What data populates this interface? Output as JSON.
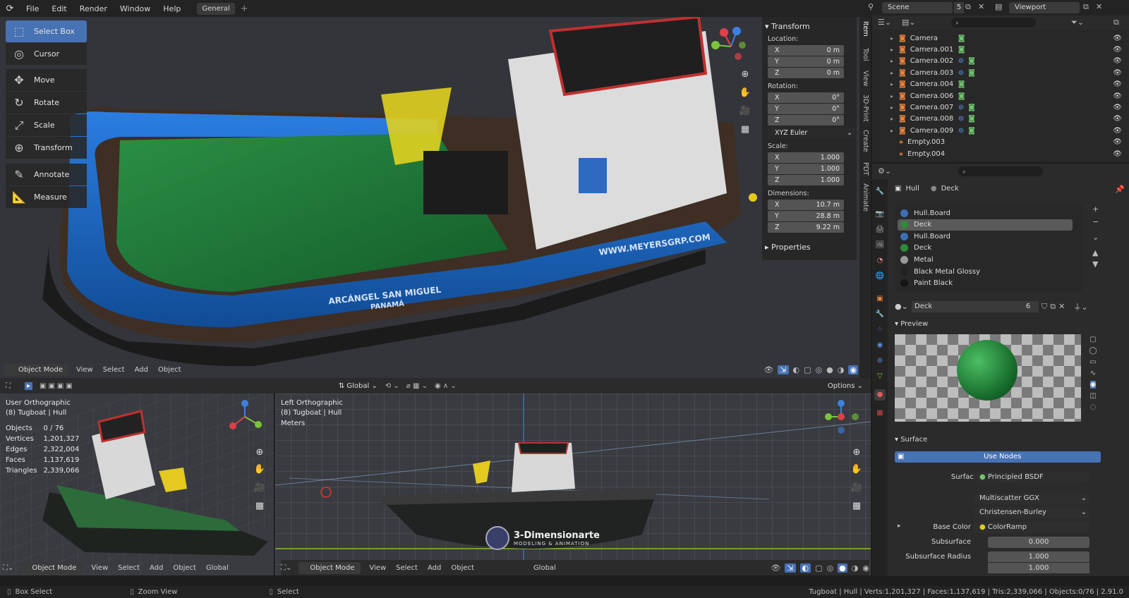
{
  "menubar": {
    "items": [
      "File",
      "Edit",
      "Render",
      "Window",
      "Help"
    ],
    "workspace_tab": "General",
    "add_tab": "+",
    "scene": "Scene",
    "scene_count": "5",
    "view_layer": "Viewport"
  },
  "tools": [
    {
      "label": "Select Box",
      "icon": "select-box-icon",
      "glyph": "⬚"
    },
    {
      "label": "Cursor",
      "icon": "cursor-icon",
      "glyph": "◎"
    },
    {
      "label": "Move",
      "icon": "move-icon",
      "glyph": "✥"
    },
    {
      "label": "Rotate",
      "icon": "rotate-icon",
      "glyph": "↻"
    },
    {
      "label": "Scale",
      "icon": "scale-icon",
      "glyph": "⤢"
    },
    {
      "label": "Transform",
      "icon": "transform-icon",
      "glyph": "⊕"
    },
    {
      "label": "Annotate",
      "icon": "annotate-icon",
      "glyph": "✎"
    },
    {
      "label": "Measure",
      "icon": "measure-icon",
      "glyph": "📐"
    }
  ],
  "viewport_labels": {
    "ship_url": "WWW.MEYERSGRP.COM",
    "ship_name": "ARCÁNGEL SAN MIGUEL",
    "ship_port": "PANAMÁ"
  },
  "npanel": {
    "title": "Transform",
    "location_label": "Location:",
    "location": [
      [
        "X",
        "0 m"
      ],
      [
        "Y",
        "0 m"
      ],
      [
        "Z",
        "0 m"
      ]
    ],
    "rotation_label": "Rotation:",
    "rotation": [
      [
        "X",
        "0°"
      ],
      [
        "Y",
        "0°"
      ],
      [
        "Z",
        "0°"
      ]
    ],
    "rotation_mode": "XYZ Euler",
    "scale_label": "Scale:",
    "scale": [
      [
        "X",
        "1.000"
      ],
      [
        "Y",
        "1.000"
      ],
      [
        "Z",
        "1.000"
      ]
    ],
    "dimensions_label": "Dimensions:",
    "dimensions": [
      [
        "X",
        "10.7 m"
      ],
      [
        "Y",
        "28.8 m"
      ],
      [
        "Z",
        "9.22 m"
      ]
    ],
    "properties": "Properties",
    "tabs": [
      "Item",
      "Tool",
      "View",
      "3D-Print",
      "Create",
      "PDT",
      "Animate"
    ]
  },
  "main_header": {
    "mode": "Object Mode",
    "menus": [
      "View",
      "Select",
      "Add",
      "Object"
    ]
  },
  "mid_toolbar": {
    "orientation": "Global",
    "options": "Options"
  },
  "left_view": {
    "title": "User Orthographic",
    "subtitle": "(8) Tugboat | Hull",
    "stats": [
      [
        "Objects",
        "0 / 76"
      ],
      [
        "Vertices",
        "1,201,327"
      ],
      [
        "Edges",
        "2,322,004"
      ],
      [
        "Faces",
        "1,137,619"
      ],
      [
        "Triangles",
        "2,339,066"
      ]
    ],
    "mode": "Object Mode",
    "menus": [
      "View",
      "Select",
      "Add",
      "Object"
    ],
    "orientation": "Global"
  },
  "right_view": {
    "title": "Left Orthographic",
    "subtitle": "(8) Tugboat | Hull",
    "units": "Meters",
    "mode": "Object Mode",
    "menus": [
      "View",
      "Select",
      "Add",
      "Object"
    ],
    "orientation": "Global",
    "watermark_title": "3-Dimensionarte",
    "watermark_sub": "MODELING & ANIMATION"
  },
  "outliner": {
    "rows": [
      {
        "name": "Camera",
        "icons": 1
      },
      {
        "name": "Camera.001",
        "icons": 1
      },
      {
        "name": "Camera.002",
        "icons": 2
      },
      {
        "name": "Camera.003",
        "icons": 2
      },
      {
        "name": "Camera.004",
        "icons": 1
      },
      {
        "name": "Camera.006",
        "icons": 1
      },
      {
        "name": "Camera.007",
        "icons": 2
      },
      {
        "name": "Camera.008",
        "icons": 2
      },
      {
        "name": "Camera.009",
        "icons": 2
      },
      {
        "name": "Empty.003",
        "icons": 0
      },
      {
        "name": "Empty.004",
        "icons": 0
      }
    ]
  },
  "properties": {
    "breadcrumb": [
      "Hull",
      "Deck"
    ],
    "materials": [
      {
        "name": "Hull.Board",
        "color": "#3a6fb5"
      },
      {
        "name": "Deck",
        "color": "#2f8a3a",
        "selected": true
      },
      {
        "name": "Hull.Board",
        "color": "#3a6fb5"
      },
      {
        "name": "Deck",
        "color": "#2f8a3a"
      },
      {
        "name": "Metal",
        "color": "#9a9a9a"
      },
      {
        "name": "Black Metal Glossy",
        "color": "#222222"
      },
      {
        "name": "Paint Black",
        "color": "#151515"
      }
    ],
    "material_name": "Deck",
    "material_users": "6",
    "preview": "Preview",
    "surface_section": "Surface",
    "use_nodes": "Use Nodes",
    "surface_label": "Surface",
    "surface_value": "Principled BSDF",
    "distribution": "Multiscatter GGX",
    "subsurface_method": "Christensen-Burley",
    "base_color_label": "Base Color",
    "base_color_value": "ColorRamp",
    "subsurface_label": "Subsurface",
    "subsurface_value": "0.000",
    "subsurface_radius_label": "Subsurface Radius",
    "subsurface_radius": [
      "1.000",
      "1.000"
    ]
  },
  "statusbar": {
    "left": [
      "Box Select",
      "Zoom View",
      "Select"
    ],
    "right": "Tugboat | Hull | Verts:1,201,327 | Faces:1,137,619 | Tris:2,339,066 | Objects:0/76 | 2.91.0"
  },
  "colors": {
    "accent": "#4772b3",
    "hull": "#1e6fd0",
    "deck": "#1f7a3a",
    "axis_x": "#e0404a",
    "axis_y": "#7ac43a",
    "axis_z": "#3c80e0"
  }
}
